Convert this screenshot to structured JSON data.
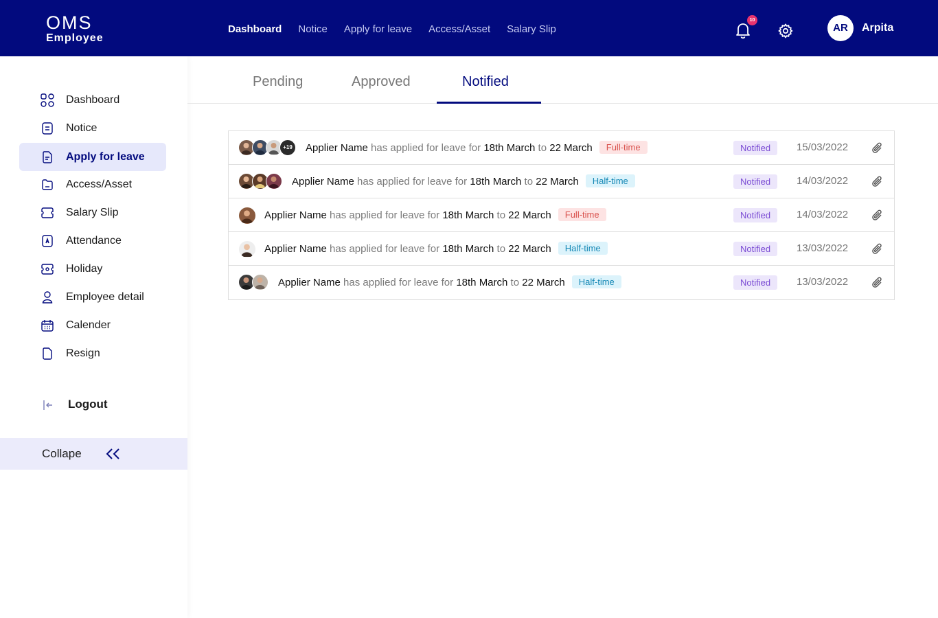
{
  "header": {
    "logo_line1": "OMS",
    "logo_line2": "Employee",
    "nav": [
      "Dashboard",
      "Notice",
      "Apply for leave",
      "Access/Asset",
      "Salary Slip"
    ],
    "notification_count": "10",
    "user_initials": "AR",
    "user_name": "Arpita"
  },
  "sidebar": {
    "items": [
      {
        "label": "Dashboard",
        "icon": "grid-icon"
      },
      {
        "label": "Notice",
        "icon": "notice-icon"
      },
      {
        "label": "Apply for leave",
        "icon": "document-icon",
        "active": true
      },
      {
        "label": "Access/Asset",
        "icon": "folder-icon"
      },
      {
        "label": "Salary Slip",
        "icon": "ticket-icon"
      },
      {
        "label": "Attendance",
        "icon": "attendance-icon"
      },
      {
        "label": "Holiday",
        "icon": "holiday-icon"
      },
      {
        "label": "Employee detail",
        "icon": "person-icon"
      },
      {
        "label": "Calender",
        "icon": "calendar-icon"
      },
      {
        "label": "Resign",
        "icon": "resign-icon"
      }
    ],
    "logout_label": "Logout",
    "collapse_label": "Collape"
  },
  "tabs": {
    "pending": "Pending",
    "approved": "Approved",
    "notified": "Notified",
    "active": "notified"
  },
  "leave_rows": [
    {
      "name": "Applier Name",
      "text": "has applied for leave for",
      "from": "18th March",
      "to_word": "to",
      "to": "22 March",
      "type": "Full-time",
      "status": "Notified",
      "date": "15/03/2022",
      "extra_count": "+19"
    },
    {
      "name": "Applier Name",
      "text": "has applied for leave for",
      "from": "18th March",
      "to_word": "to",
      "to": "22 March",
      "type": "Half-time",
      "status": "Notified",
      "date": "14/03/2022"
    },
    {
      "name": "Applier Name",
      "text": "has applied for leave for",
      "from": "18th March",
      "to_word": "to",
      "to": "22 March",
      "type": "Full-time",
      "status": "Notified",
      "date": "14/03/2022"
    },
    {
      "name": "Applier Name",
      "text": "has applied for leave for",
      "from": "18th March",
      "to_word": "to",
      "to": "22 March",
      "type": "Half-time",
      "status": "Notified",
      "date": "13/03/2022"
    },
    {
      "name": "Applier Name",
      "text": "has applied for leave for",
      "from": "18th March",
      "to_word": "to",
      "to": "22 March",
      "type": "Half-time",
      "status": "Notified",
      "date": "13/03/2022"
    }
  ],
  "colors": {
    "brand": "#020a7e",
    "active_bg": "#e6e8fb",
    "status_bg": "#ece6fb",
    "status_text": "#7a4bd4",
    "full_time": "#d9534f",
    "half_time": "#1588b5",
    "badge": "#e8336f"
  }
}
